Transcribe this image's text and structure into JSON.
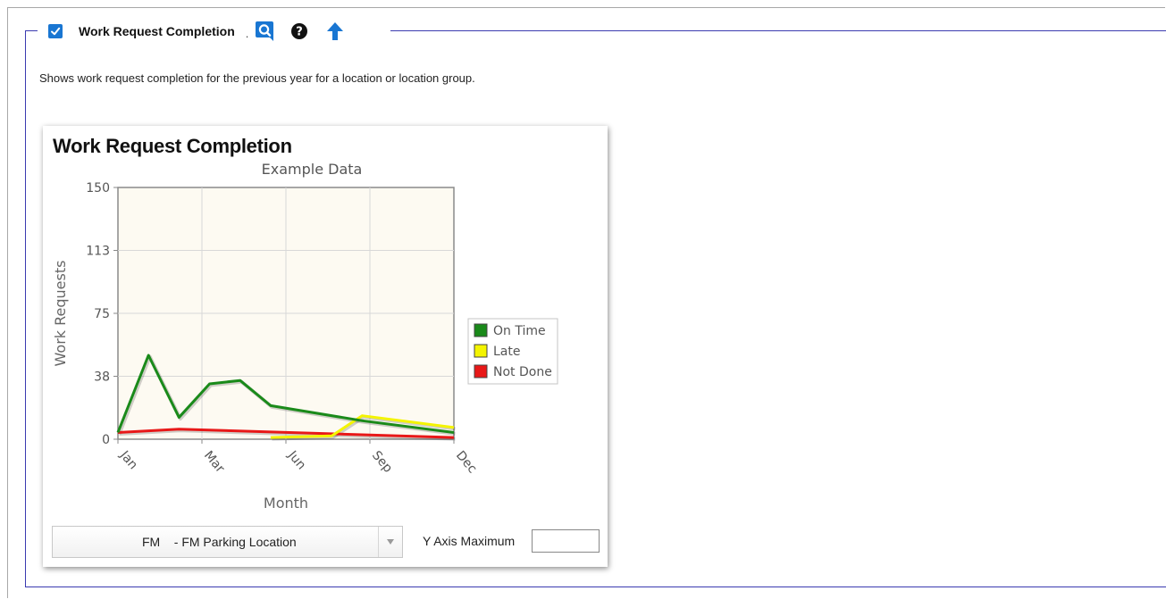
{
  "section": {
    "checked": true,
    "title": "Work Request Completion",
    "separator": ".",
    "description": "Shows work request completion for the previous year for a location or location group."
  },
  "widget": {
    "title": "Work Request Completion",
    "location_select": {
      "selected": "FM    - FM Parking Location"
    },
    "y_axis_max": {
      "label": "Y Axis Maximum",
      "value": ""
    }
  },
  "colors": {
    "accent": "#1976d2",
    "fieldset_border": "#3a3ab0",
    "plot_background": "#fdfaf2",
    "on_time": "#1a8a1a",
    "late": "#f4f400",
    "not_done": "#e81818"
  },
  "icons": {
    "checkbox": "checkmark-icon",
    "search": "search-icon",
    "help": "help-icon",
    "collapse": "arrow-up-icon",
    "select": "chevron-down-icon"
  },
  "chart_data": {
    "type": "line",
    "title": "Example Data",
    "xlabel": "Month",
    "ylabel": "Work Requests",
    "x_tick_labels": [
      "Jan",
      "Mar",
      "Jun",
      "Sep",
      "Dec"
    ],
    "y_tick_labels": [
      "0",
      "38",
      "75",
      "113",
      "150"
    ],
    "ylim": [
      0,
      150
    ],
    "xlim": [
      1,
      12
    ],
    "grid": true,
    "legend_position": "right",
    "series": [
      {
        "name": "On Time",
        "color": "#1a8a1a",
        "points": [
          [
            1,
            4
          ],
          [
            2,
            50
          ],
          [
            3,
            13
          ],
          [
            4,
            33
          ],
          [
            5,
            35
          ],
          [
            6,
            20
          ],
          [
            9,
            11
          ],
          [
            12,
            4
          ]
        ]
      },
      {
        "name": "Late",
        "color": "#f4f400",
        "points": [
          [
            6,
            1
          ],
          [
            8,
            2
          ],
          [
            9,
            14
          ],
          [
            12,
            7
          ]
        ]
      },
      {
        "name": "Not Done",
        "color": "#e81818",
        "points": [
          [
            1,
            4
          ],
          [
            3,
            6
          ],
          [
            12,
            1
          ]
        ]
      }
    ]
  }
}
